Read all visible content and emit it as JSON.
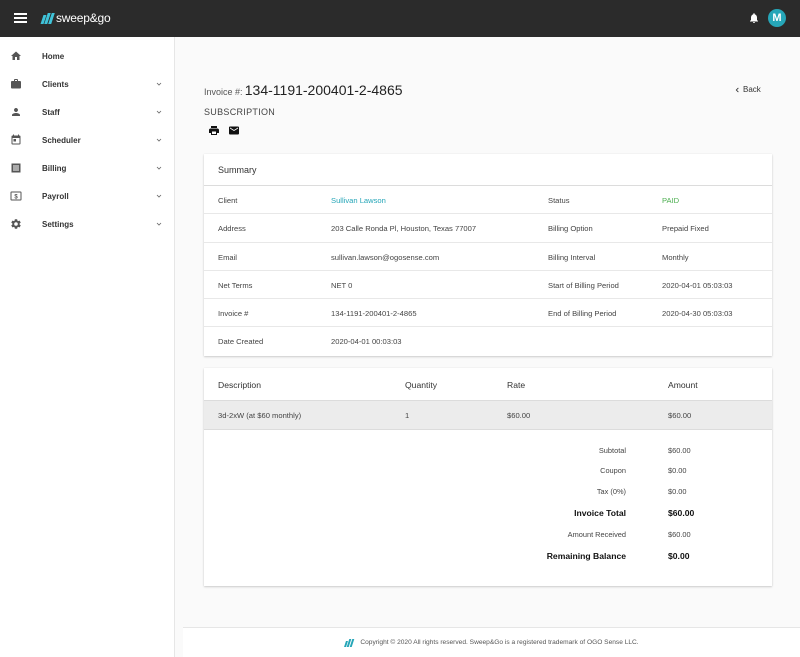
{
  "header": {
    "logo_text": "sweep&go",
    "avatar_initial": "M"
  },
  "sidebar": {
    "items": [
      {
        "label": "Home",
        "icon": "home-icon",
        "expandable": false
      },
      {
        "label": "Clients",
        "icon": "briefcase-icon",
        "expandable": true
      },
      {
        "label": "Staff",
        "icon": "person-icon",
        "expandable": true
      },
      {
        "label": "Scheduler",
        "icon": "calendar-icon",
        "expandable": true
      },
      {
        "label": "Billing",
        "icon": "list-icon",
        "expandable": true
      },
      {
        "label": "Payroll",
        "icon": "dollar-icon",
        "expandable": true
      },
      {
        "label": "Settings",
        "icon": "gear-icon",
        "expandable": true
      }
    ]
  },
  "page": {
    "invoice_label": "Invoice #:",
    "invoice_number": "134-1191-200401-2-4865",
    "subscription_label": "SUBSCRIPTION",
    "back_label": "Back"
  },
  "summary": {
    "title": "Summary",
    "rows": [
      {
        "l1": "Client",
        "v1": "Sullivan Lawson",
        "l2": "Status",
        "v2": "PAID"
      },
      {
        "l1": "Address",
        "v1": "203 Calle Ronda Pl, Houston, Texas 77007",
        "l2": "Billing Option",
        "v2": "Prepaid Fixed"
      },
      {
        "l1": "Email",
        "v1": "sullivan.lawson@ogosense.com",
        "l2": "Billing Interval",
        "v2": "Monthly"
      },
      {
        "l1": "Net Terms",
        "v1": "NET 0",
        "l2": "Start of Billing Period",
        "v2": "2020-04-01 05:03:03"
      },
      {
        "l1": "Invoice #",
        "v1": "134-1191-200401-2-4865",
        "l2": "End of Billing Period",
        "v2": "2020-04-30 05:03:03"
      },
      {
        "l1": "Date Created",
        "v1": "2020-04-01 00:03:03",
        "l2": "",
        "v2": ""
      }
    ]
  },
  "items": {
    "headers": [
      "Description",
      "Quantity",
      "Rate",
      "Amount"
    ],
    "rows": [
      {
        "description": "3d-2xW (at $60 monthly)",
        "quantity": "1",
        "rate": "$60.00",
        "amount": "$60.00"
      }
    ],
    "totals": [
      {
        "label": "Subtotal",
        "value": "$60.00",
        "bold": false
      },
      {
        "label": "Coupon",
        "value": "$0.00",
        "bold": false
      },
      {
        "label": "Tax (0%)",
        "value": "$0.00",
        "bold": false
      },
      {
        "label": "Invoice Total",
        "value": "$60.00",
        "bold": true
      },
      {
        "label": "Amount Received",
        "value": "$60.00",
        "bold": false
      },
      {
        "label": "Remaining Balance",
        "value": "$0.00",
        "bold": true
      }
    ]
  },
  "footer": {
    "text": "Copyright © 2020 All rights reserved. Sweep&Go is a registered trademark of OGO Sense LLC."
  },
  "colors": {
    "accent": "#26a6b8",
    "paid": "#4caf50",
    "topbar": "#2b2b2b"
  }
}
